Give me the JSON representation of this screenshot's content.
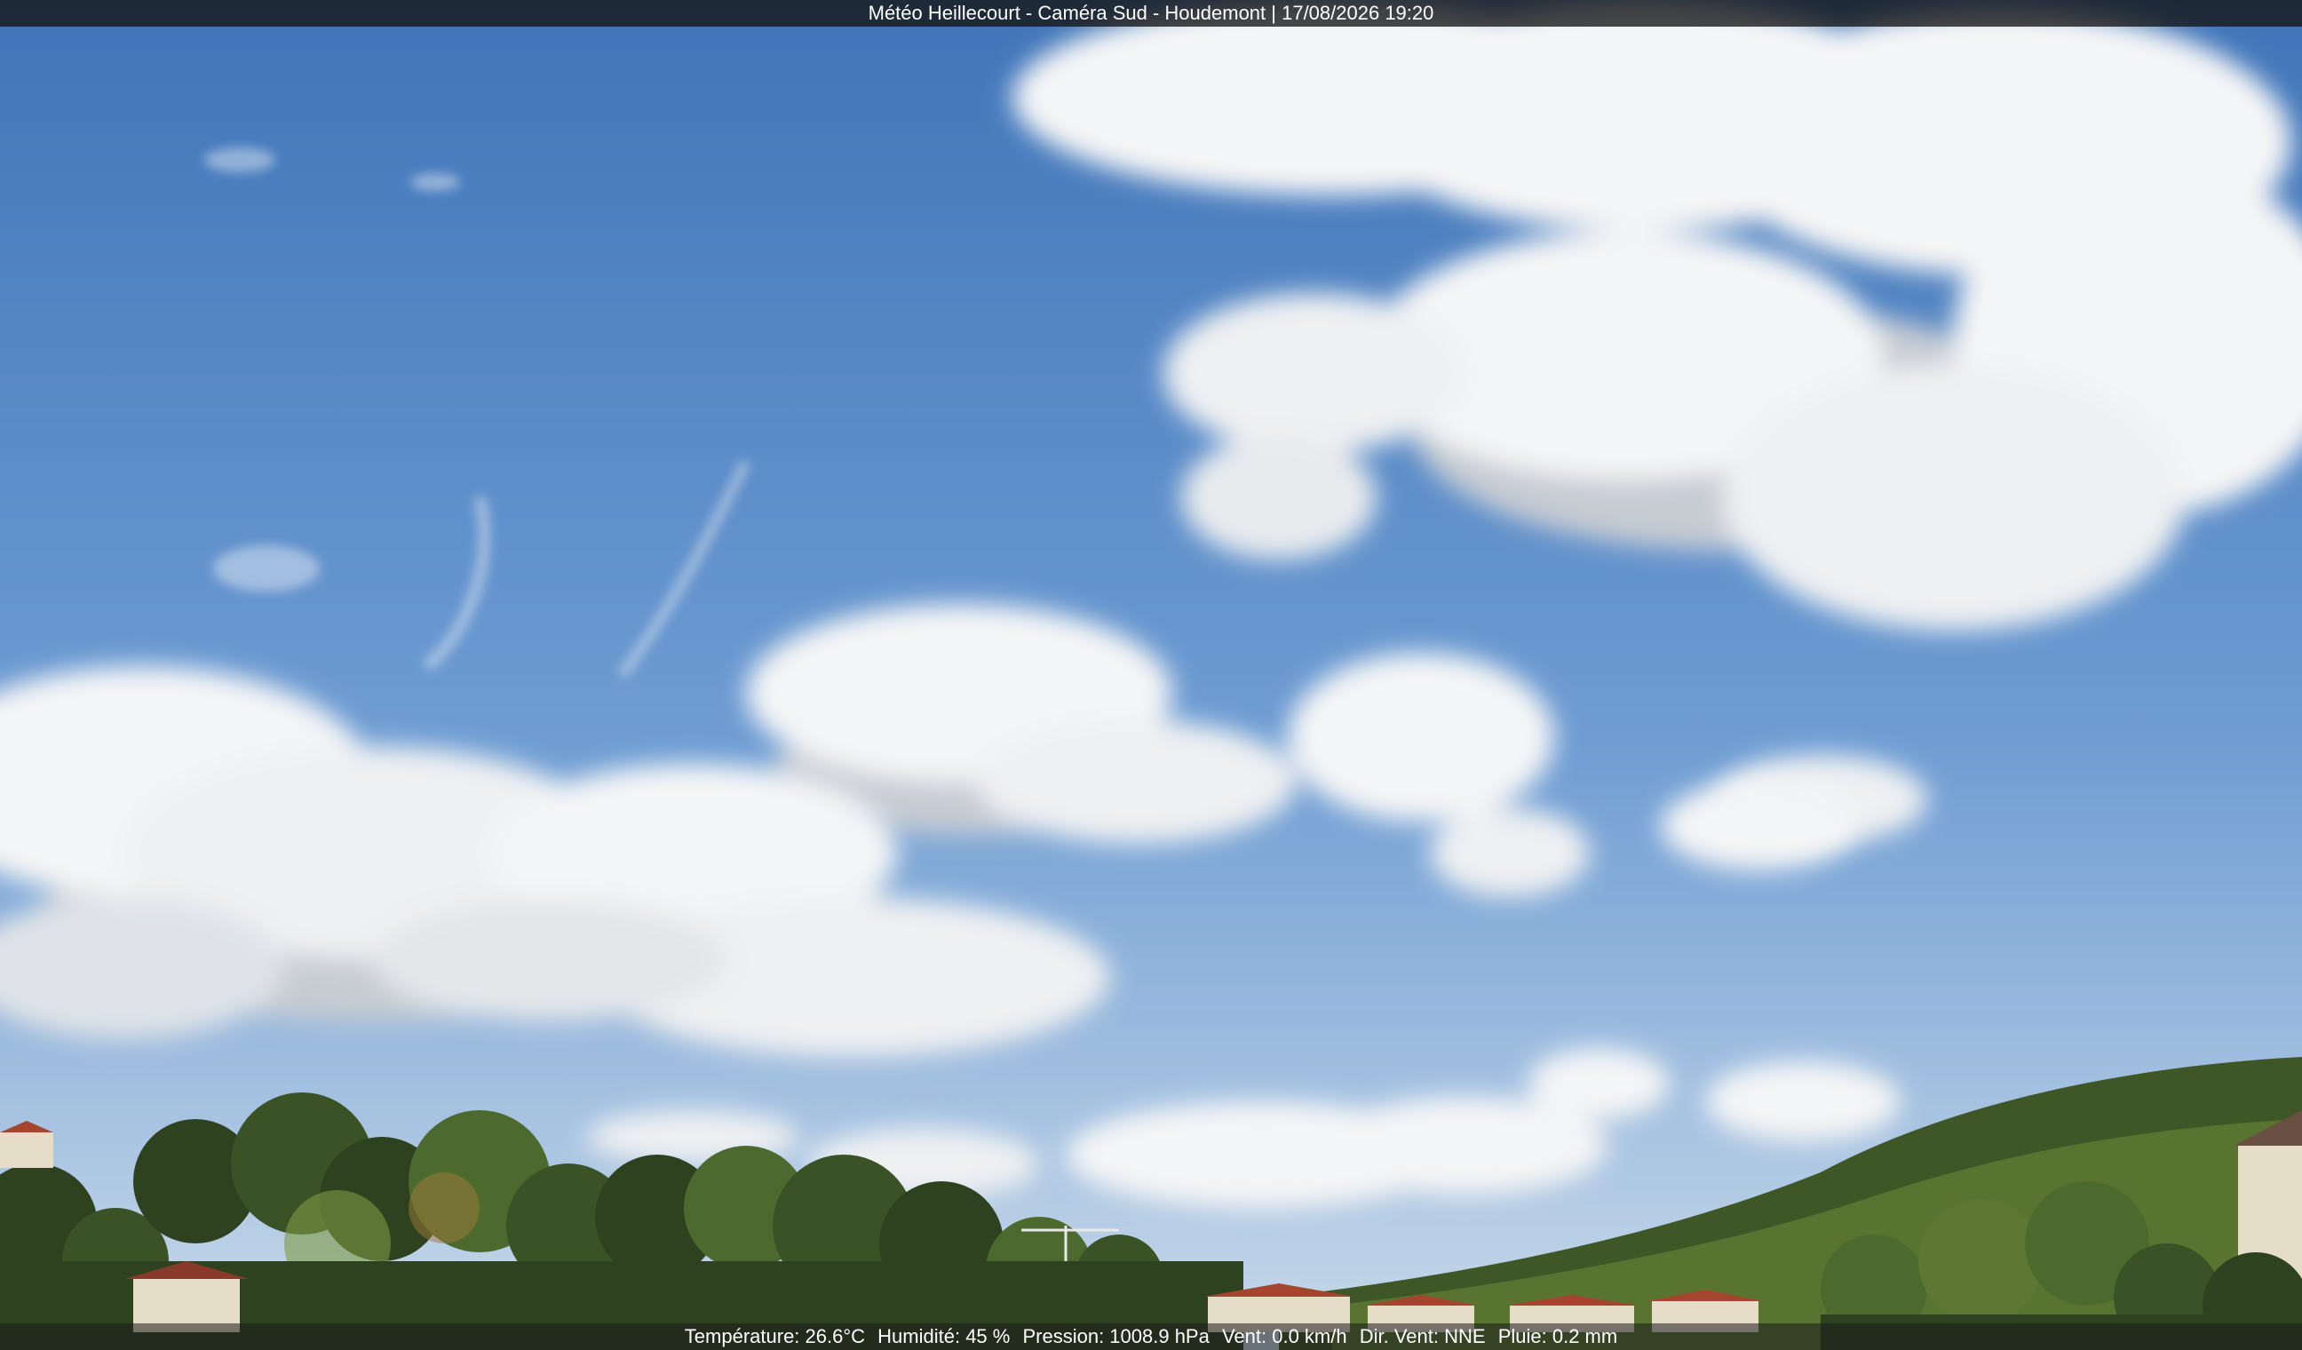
{
  "overlay": {
    "title": "Météo Heillecourt - Caméra Sud - Houdemont | 17/08/2026 19:20",
    "weather": {
      "temperature": "Température: 26.6°C",
      "humidity": "Humidité: 45 %",
      "pressure": "Pression: 1008.9 hPa",
      "wind_speed": "Vent: 0.0 km/h",
      "wind_dir": "Dir. Vent: NNE",
      "rain": "Pluie: 0.2 mm"
    }
  },
  "scene": {
    "sky_top": "#3f74b8",
    "sky_mid": "#6f9dd3",
    "sky_horizon": "#c9daea",
    "cloud_color": "#f4f5f6",
    "cloud_shadow": "#c7ccd3",
    "tree_dark": "#2e4220",
    "tree_mid": "#4d6a2e",
    "tree_light": "#7f9a44",
    "roof_color": "#a5452f",
    "wall_color": "#e6ddc9"
  }
}
